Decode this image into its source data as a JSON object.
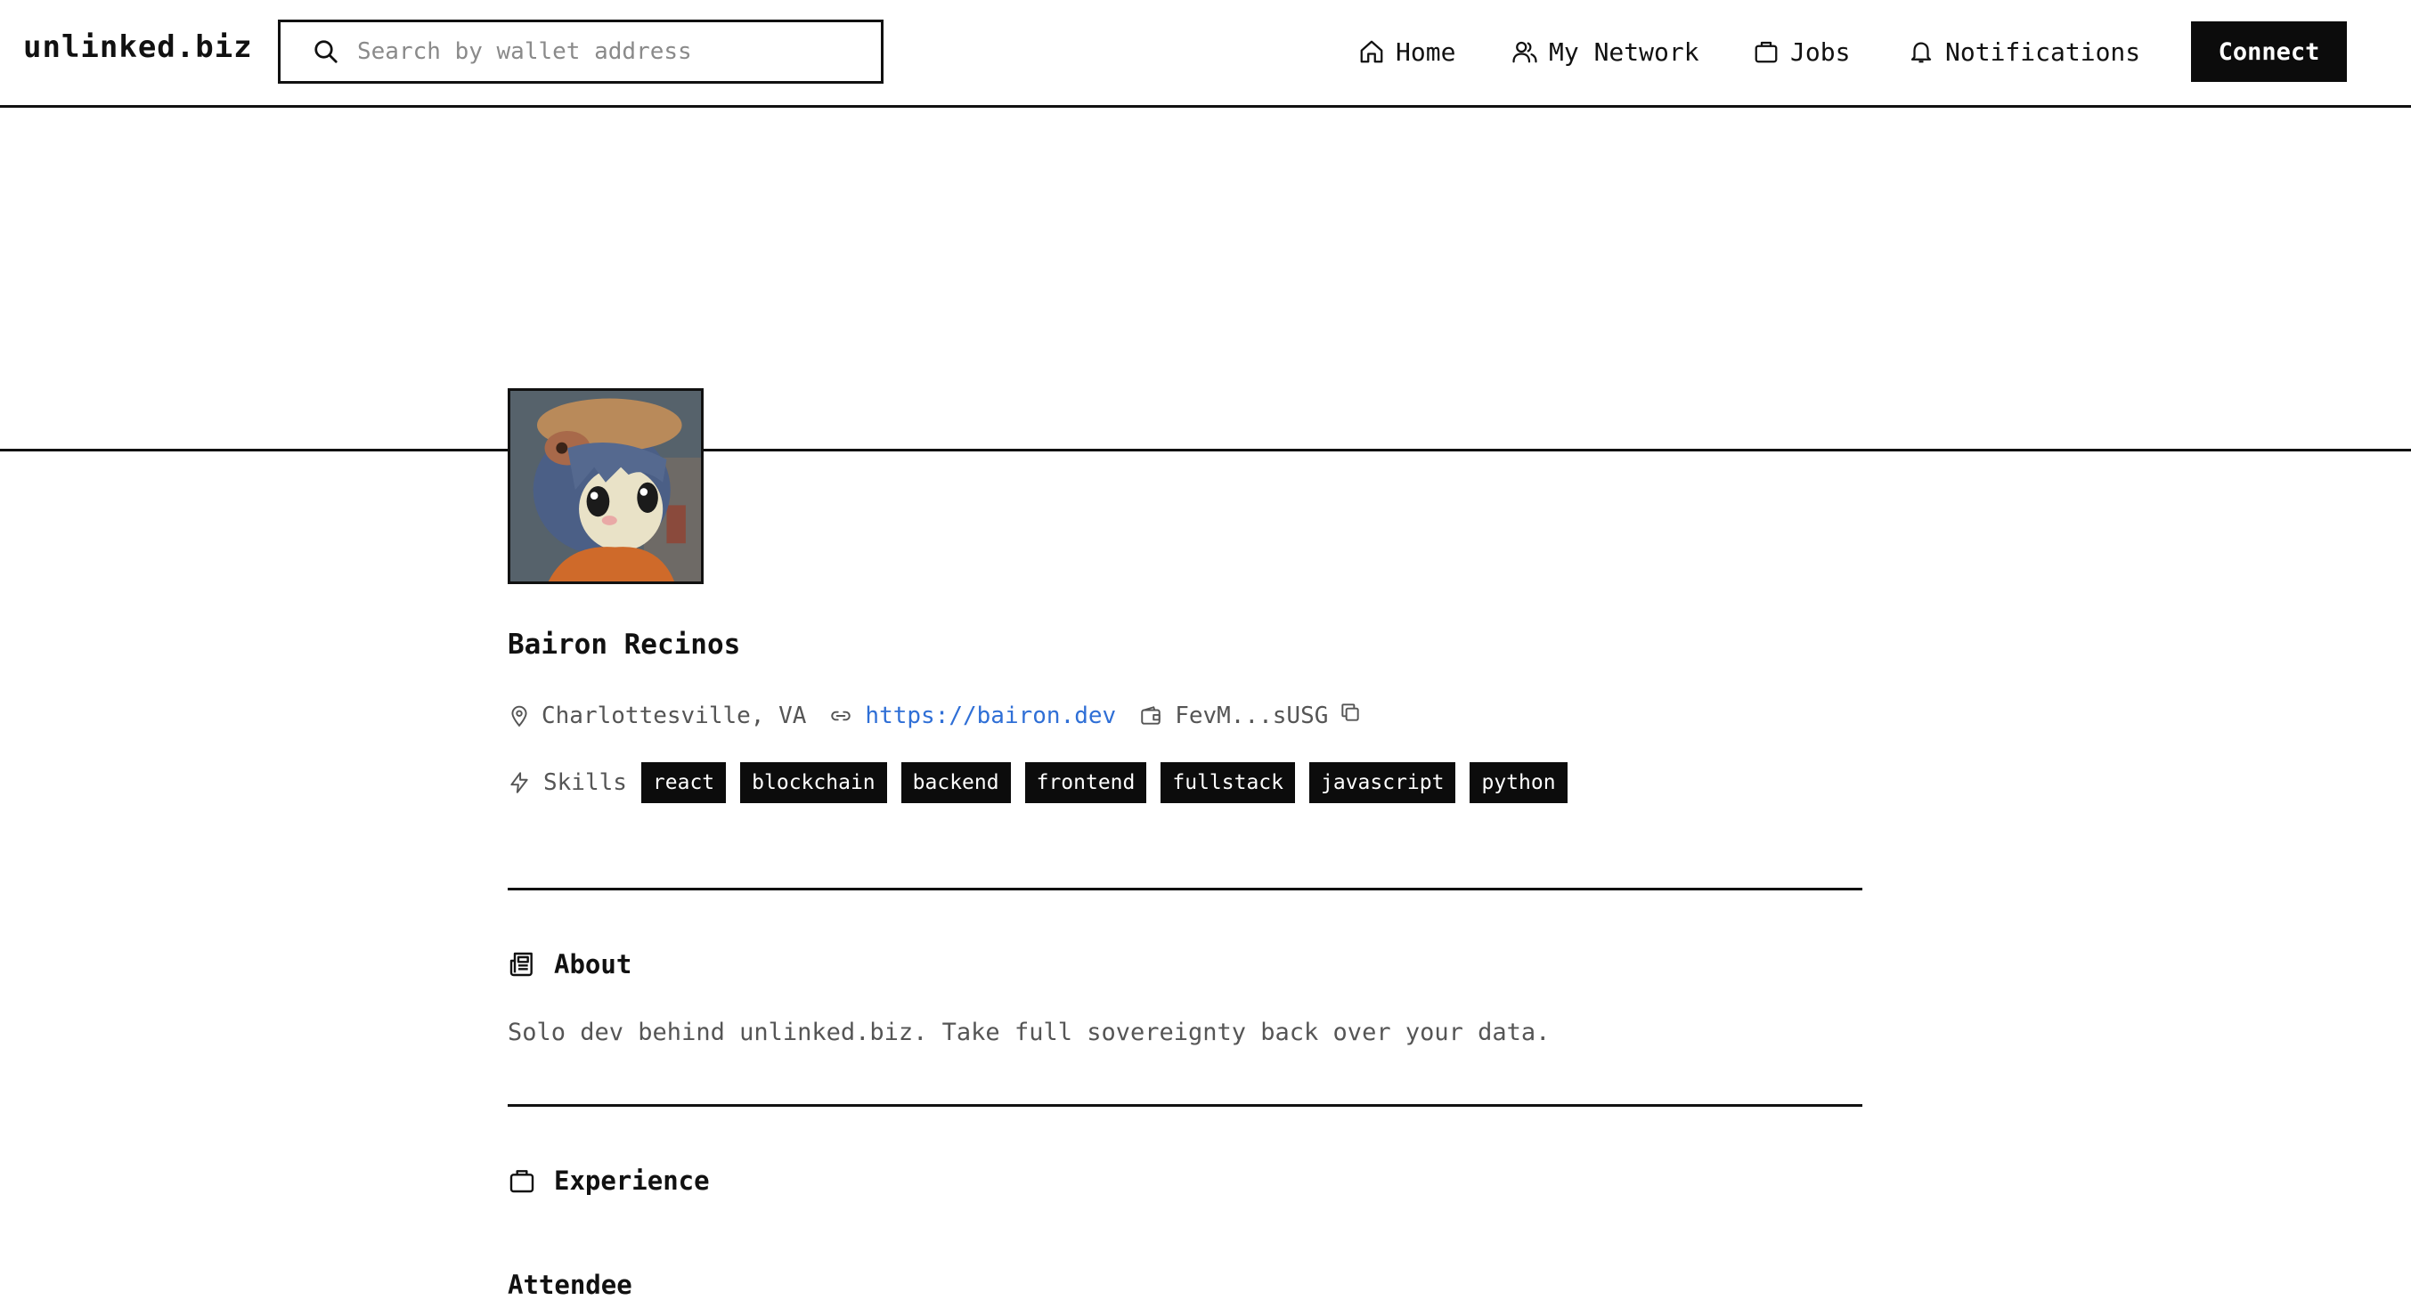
{
  "header": {
    "logo": "unlinked.biz",
    "search": {
      "placeholder": "Search by wallet address",
      "value": ""
    },
    "nav": [
      {
        "label": "Home",
        "icon": "home-icon"
      },
      {
        "label": "My Network",
        "icon": "users-icon"
      },
      {
        "label": "Jobs",
        "icon": "briefcase-icon"
      },
      {
        "label": "Notifications",
        "icon": "bell-icon"
      }
    ],
    "connect_label": "Connect"
  },
  "profile": {
    "avatar_icon": "avatar-image",
    "name": "Bairon Recinos",
    "location": "Charlottesville, VA",
    "website": "https://bairon.dev",
    "wallet": "FevM...sUSG",
    "skills_label": "Skills",
    "skills": [
      "react",
      "blockchain",
      "backend",
      "frontend",
      "fullstack",
      "javascript",
      "python"
    ]
  },
  "about": {
    "title": "About",
    "text": "Solo dev behind unlinked.biz. Take full sovereignty back over your data."
  },
  "experience": {
    "title": "Experience",
    "items": [
      {
        "title": "Attendee"
      }
    ]
  },
  "colors": {
    "text": "#111111",
    "muted": "#555555",
    "link": "#2f6fd6",
    "tag_bg": "#0c0c0c",
    "tag_text": "#ffffff"
  }
}
